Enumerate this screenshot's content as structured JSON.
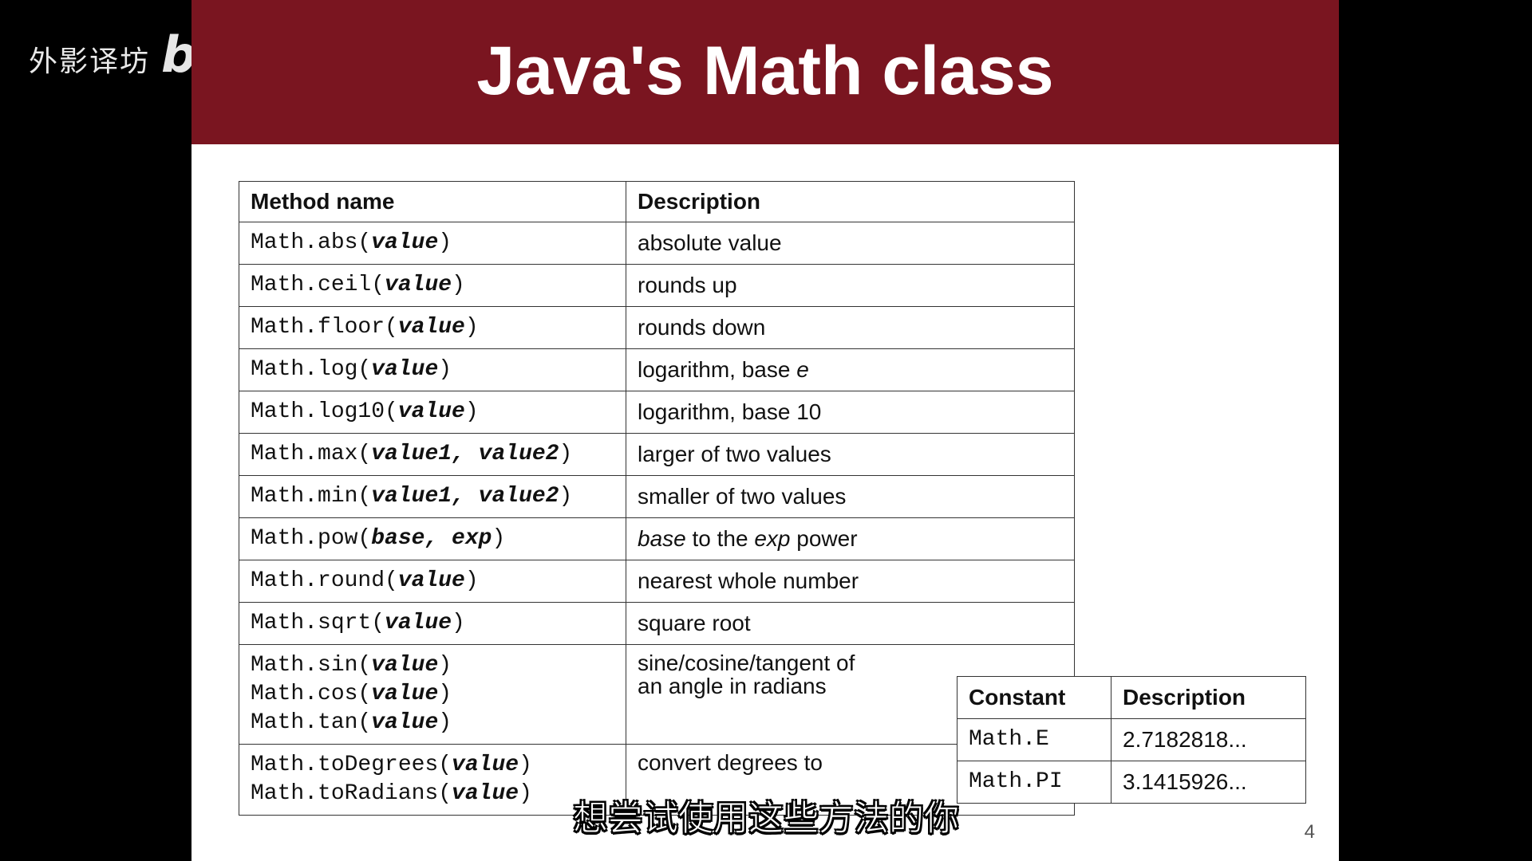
{
  "watermark": {
    "text": "外影译坊",
    "logo": "bilibili"
  },
  "slide": {
    "title": "Java's Math class",
    "page_number": "4",
    "methods_table": {
      "headers": [
        "Method name",
        "Description"
      ],
      "rows": [
        {
          "method": "Math.abs(",
          "params": "value",
          "close": ")",
          "desc": "absolute value"
        },
        {
          "method": "Math.ceil(",
          "params": "value",
          "close": ")",
          "desc": "rounds up"
        },
        {
          "method": "Math.floor(",
          "params": "value",
          "close": ")",
          "desc": "rounds down"
        },
        {
          "method": "Math.log(",
          "params": "value",
          "close": ")",
          "desc": "logarithm, base ",
          "desc_italic": "e"
        },
        {
          "method": "Math.log10(",
          "params": "value",
          "close": ")",
          "desc": "logarithm, base 10"
        },
        {
          "method": "Math.max(",
          "params": "value1, value2",
          "close": ")",
          "desc": "larger of two values"
        },
        {
          "method": "Math.min(",
          "params": "value1, value2",
          "close": ")",
          "desc": "smaller of two values"
        },
        {
          "method": "Math.pow(",
          "params": "base, exp",
          "close": ")",
          "desc_italic_start": "base",
          "desc_mid": " to the ",
          "desc_italic_mid": "exp",
          "desc_end": " power"
        },
        {
          "method": "Math.round(",
          "params": "value",
          "close": ")",
          "desc": "nearest whole number"
        },
        {
          "method": "Math.sqrt(",
          "params": "value",
          "close": ")",
          "desc": "square root"
        }
      ],
      "trig": {
        "lines": [
          {
            "method": "Math.sin(",
            "params": "value",
            "close": ")"
          },
          {
            "method": "Math.cos(",
            "params": "value",
            "close": ")"
          },
          {
            "method": "Math.tan(",
            "params": "value",
            "close": ")"
          }
        ],
        "desc1": "sine/cosine/tangent of",
        "desc2": "an angle in radians"
      },
      "convert": {
        "lines": [
          {
            "method": "Math.toDegrees(",
            "params": "value",
            "close": ")"
          },
          {
            "method": "Math.toRadians(",
            "params": "value",
            "close": ")"
          }
        ],
        "desc1": "convert degrees to"
      }
    },
    "constants_table": {
      "headers": [
        "Constant",
        "Description"
      ],
      "rows": [
        {
          "name": "Math.E",
          "value": "2.7182818..."
        },
        {
          "name": "Math.PI",
          "value": "3.1415926..."
        }
      ]
    }
  },
  "subtitle": "想尝试使用这些方法的你"
}
